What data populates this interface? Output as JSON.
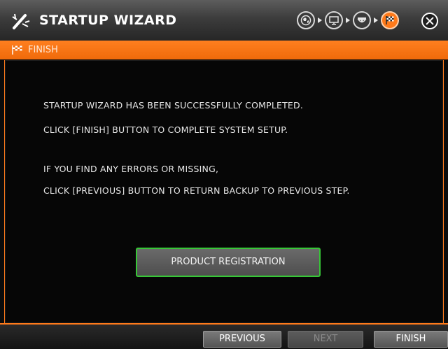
{
  "window": {
    "title": "STARTUP WIZARD",
    "logo_icon": "wizard-wand-icon",
    "steps": [
      {
        "icon": "globe-icon",
        "state": "done"
      },
      {
        "icon": "monitor-icon",
        "state": "done"
      },
      {
        "icon": "camera-icon",
        "state": "done"
      },
      {
        "icon": "finish-flag-icon",
        "state": "active"
      }
    ],
    "close_icon": "close-icon"
  },
  "section": {
    "title": "FINISH",
    "icon": "finish-flag-icon"
  },
  "content": {
    "lines": [
      "STARTUP WIZARD HAS BEEN SUCCESSFULLY COMPLETED.",
      "CLICK [FINISH] BUTTON TO COMPLETE SYSTEM SETUP.",
      "IF YOU FIND ANY ERRORS OR MISSING,",
      "CLICK [PREVIOUS] BUTTON TO RETURN BACKUP TO PREVIOUS STEP."
    ],
    "product_registration_label": "PRODUCT REGISTRATION"
  },
  "footer": {
    "previous_label": "PREVIOUS",
    "next_label": "NEXT",
    "next_enabled": false,
    "finish_label": "FINISH"
  },
  "colors": {
    "accent": "#ff7a1a",
    "focus_border": "#37c637",
    "background": "#060606"
  }
}
